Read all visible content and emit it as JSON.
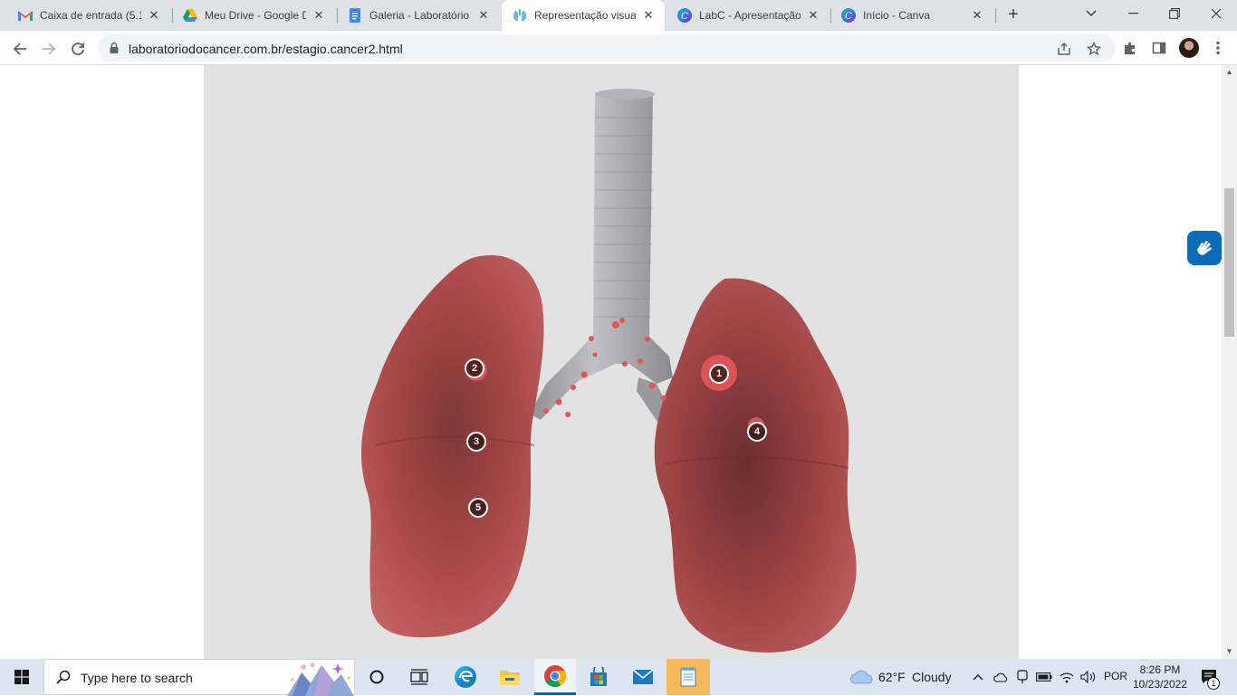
{
  "browser": {
    "tabs": [
      {
        "title": "Caixa de entrada (5.17",
        "icon": "gmail-icon"
      },
      {
        "title": "Meu Drive - Google D",
        "icon": "google-drive-icon"
      },
      {
        "title": "Galeria - Laboratório d",
        "icon": "google-docs-icon"
      },
      {
        "title": "Representação visual d",
        "icon": "labc-site-icon"
      },
      {
        "title": "LabC - Apresentação",
        "icon": "canva-icon"
      },
      {
        "title": "Início - Canva",
        "icon": "canva-icon"
      }
    ],
    "active_tab": 3,
    "url": "laboratoriodocancer.com.br/estagio.cancer2.html"
  },
  "content": {
    "tumor_markers": [
      "1",
      "2",
      "3",
      "4",
      "5"
    ],
    "lung_color": "#a84848",
    "trachea_color": "#a5a5a8",
    "tumor_color": "#e0555a",
    "background_color": "#e2e2e2",
    "accessibility_widget_icon": "vlibras-hand-icon"
  },
  "taskbar": {
    "search_placeholder": "Type here to search",
    "weather": {
      "temp": "62°F",
      "condition": "Cloudy"
    },
    "language": "POR",
    "time": "8:26 PM",
    "date": "10/23/2022",
    "notification_count": "1"
  }
}
